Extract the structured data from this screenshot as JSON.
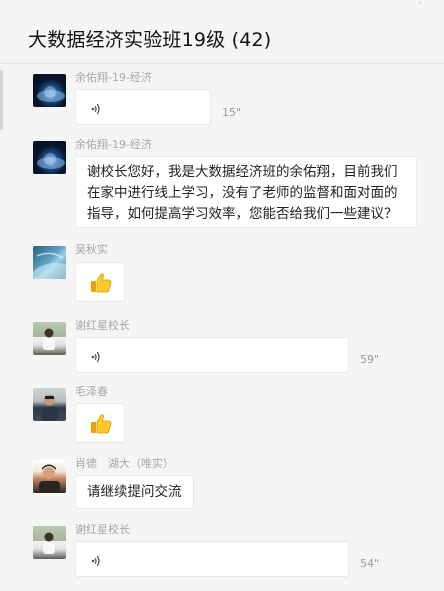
{
  "chat": {
    "title": "大数据经济实验班19级 (42)"
  },
  "messages": [
    {
      "sender": "余佑翔-19-经济",
      "type": "voice",
      "duration": "15\"",
      "avatar_icon": "earth-avatar-icon"
    },
    {
      "sender": "余佑翔-19-经济",
      "type": "text",
      "lines": [
        "谢校长您好，我是大数据经济班的余佑翔，目前我们",
        "在家中进行线上学习，没有了老师的监督和面对面的",
        "指导，如何提高学习效率，您能否给我们一些建议？"
      ],
      "avatar_icon": "earth-avatar-icon"
    },
    {
      "sender": "吴秋实",
      "type": "emoji",
      "emoji": "thumbs-up-icon",
      "avatar_icon": "blue-abstract-avatar-icon"
    },
    {
      "sender": "谢红星校长",
      "type": "voice",
      "duration": "59\"",
      "avatar_icon": "person-photo-avatar-icon"
    },
    {
      "sender": "毛泽春",
      "type": "emoji",
      "emoji": "thumbs-up-icon",
      "avatar_icon": "person-photo-avatar-icon"
    },
    {
      "sender": "肖德　湖大（唯实）",
      "type": "text",
      "lines": [
        "请继续提问交流"
      ],
      "avatar_icon": "person-photo-avatar-icon"
    },
    {
      "sender": "谢红星校长",
      "type": "voice",
      "duration": "54\"",
      "avatar_icon": "person-photo-avatar-icon"
    }
  ],
  "colors": {
    "background": "#f5f5f5",
    "bubble": "#ffffff",
    "sender_text": "#a7a7a7",
    "thumb": "#f4b400"
  }
}
